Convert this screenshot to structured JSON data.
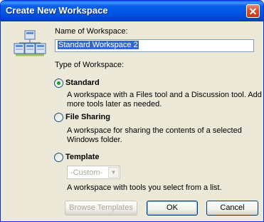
{
  "window": {
    "title": "Create New Workspace",
    "close_glyph": "✕"
  },
  "form": {
    "name_label": "Name of Workspace:",
    "name_value": "Standard Workspace 2",
    "type_label": "Type of Workspace:",
    "options": [
      {
        "label": "Standard",
        "checked": true,
        "description": "A workspace with a Files tool and a Discussion tool.  Add more tools later as needed."
      },
      {
        "label": "File Sharing",
        "checked": false,
        "description": "A workspace for sharing the contents of a selected Windows folder."
      },
      {
        "label": "Template",
        "checked": false,
        "description": "A workspace with tools you select from a list."
      }
    ],
    "template_select": {
      "value": "-Custom-",
      "enabled": false
    }
  },
  "buttons": {
    "browse": "Browse Templates",
    "ok": "OK",
    "cancel": "Cancel"
  },
  "icon": "workspace-icon"
}
